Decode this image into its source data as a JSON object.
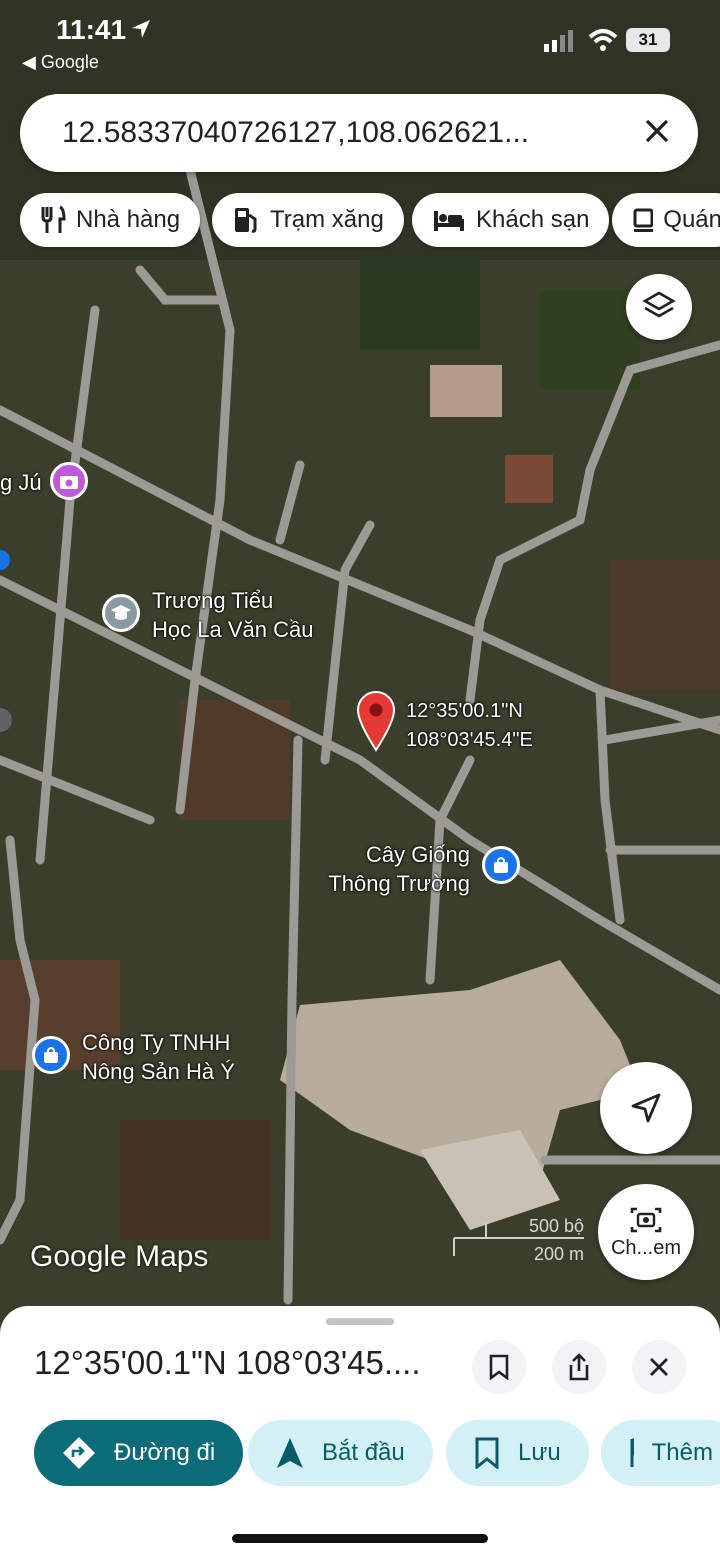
{
  "status_bar": {
    "time": "11:41",
    "back_app": "◀ Google",
    "battery": "31"
  },
  "search": {
    "value": "12.58337040726127,108.062621..."
  },
  "categories": [
    {
      "label": "Nhà hàng",
      "icon": "restaurant-icon"
    },
    {
      "label": "Trạm xăng",
      "icon": "gas-station-icon"
    },
    {
      "label": "Khách sạn",
      "icon": "hotel-icon"
    },
    {
      "label": "Quán",
      "icon": "cafe-icon"
    }
  ],
  "map": {
    "pin_label_line1": "12°35'00.1\"N",
    "pin_label_line2": "108°03'45.4\"E",
    "poi_1": "g Jú",
    "poi_2_line1": "Trương Tiểu",
    "poi_2_line2": "Học La Văn Cầu",
    "poi_3_line1": "Cây Giống",
    "poi_3_line2": "Thông Trường",
    "poi_4_line1": "Công Ty TNHH",
    "poi_4_line2": "Nông Sản Hà Ý",
    "scale_top": "500 bộ",
    "scale_bottom": "200 m",
    "watermark": "Google Maps",
    "camera_label": "Ch...em"
  },
  "colors": {
    "accent": "#0b6b78",
    "pin": "#e53935",
    "chip_secondary": "#d3f0f6"
  },
  "sheet": {
    "title": "12°35'00.1\"N 108°03'45....",
    "actions": [
      {
        "label": "Đường đi",
        "icon": "directions-icon"
      },
      {
        "label": "Bắt đầu",
        "icon": "navigation-arrow-icon"
      },
      {
        "label": "Lưu",
        "icon": "bookmark-icon"
      },
      {
        "label": "Thêm",
        "icon": "flag-icon"
      }
    ]
  }
}
